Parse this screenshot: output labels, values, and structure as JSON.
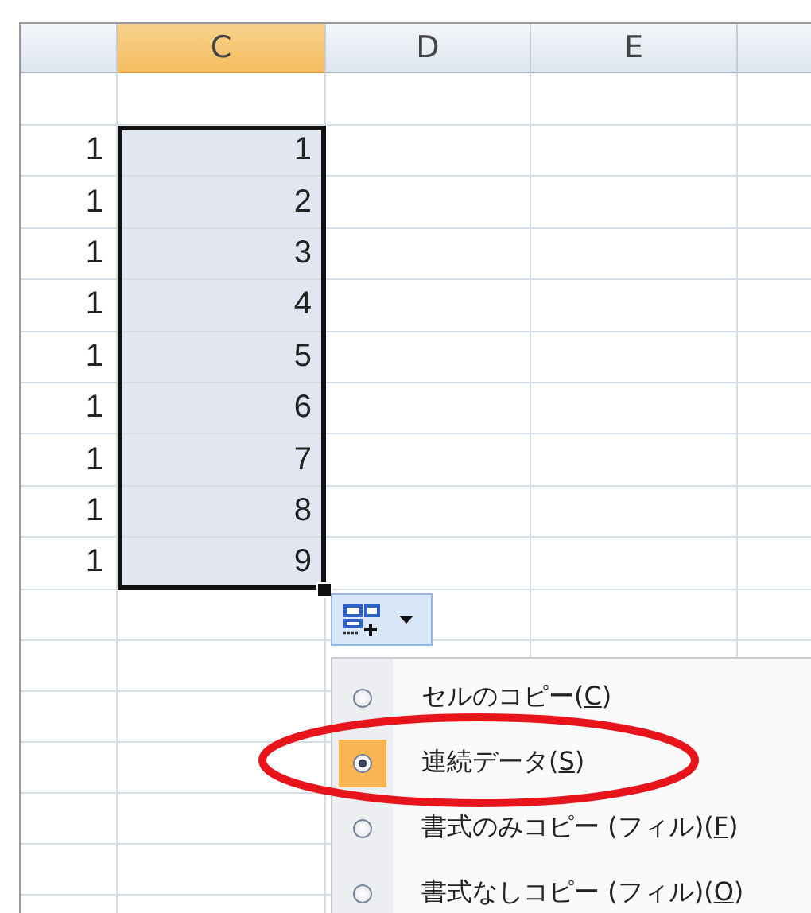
{
  "columns": [
    {
      "label": "C",
      "selected": true
    },
    {
      "label": "D",
      "selected": false
    },
    {
      "label": "E",
      "selected": false
    }
  ],
  "rows": [
    {
      "column_b": "1",
      "column_c": "1",
      "selected": true
    },
    {
      "column_b": "1",
      "column_c": "2",
      "selected": true
    },
    {
      "column_b": "1",
      "column_c": "3",
      "selected": true
    },
    {
      "column_b": "1",
      "column_c": "4",
      "selected": true
    },
    {
      "column_b": "1",
      "column_c": "5",
      "selected": true
    },
    {
      "column_b": "1",
      "column_c": "6",
      "selected": true
    },
    {
      "column_b": "1",
      "column_c": "7",
      "selected": true
    },
    {
      "column_b": "1",
      "column_c": "8",
      "selected": true
    },
    {
      "column_b": "1",
      "column_c": "9",
      "selected": true
    }
  ],
  "autofill_menu": {
    "options": [
      {
        "prefix": "セルのコピー(",
        "key": "C",
        "suffix": ")",
        "selected": false
      },
      {
        "prefix": "連続データ(",
        "key": "S",
        "suffix": ")",
        "selected": true
      },
      {
        "prefix": "書式のみコピー (フィル)(",
        "key": "F",
        "suffix": ")",
        "selected": false
      },
      {
        "prefix": "書式なしコピー (フィル)(",
        "key": "O",
        "suffix": ")",
        "selected": false
      }
    ]
  }
}
